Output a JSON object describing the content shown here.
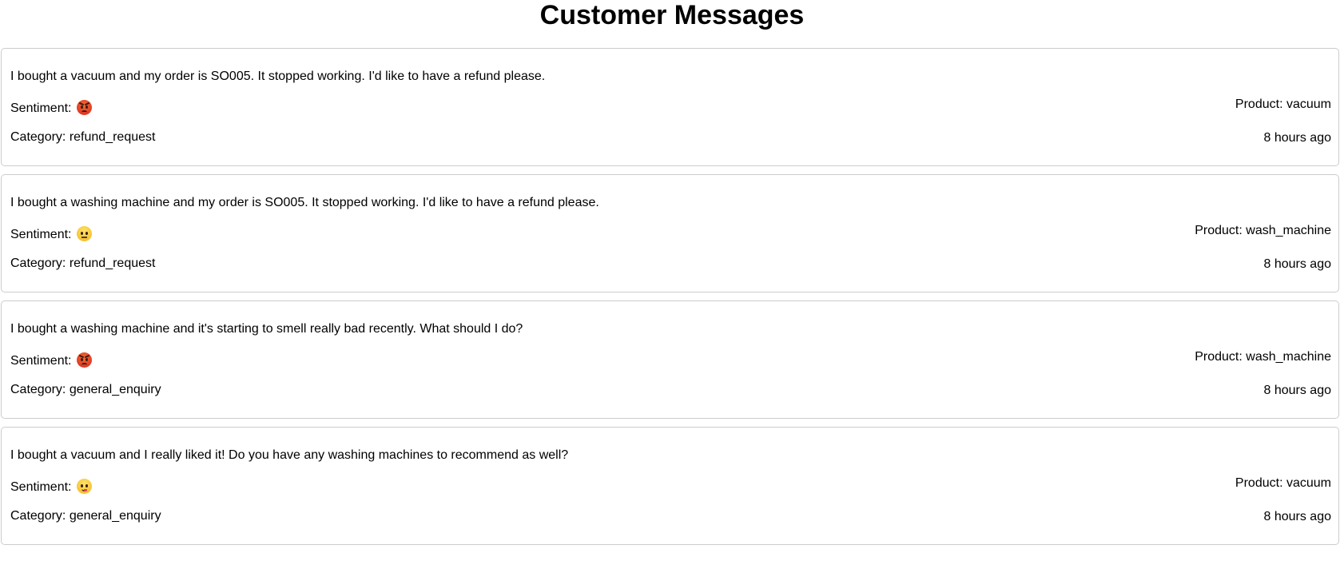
{
  "page": {
    "title": "Customer Messages"
  },
  "messages": [
    {
      "text": "I bought a vacuum and my order is SO005. It stopped working. I'd like to have a refund please.",
      "sentiment_label": "Sentiment:",
      "sentiment_icon": "angry-face-icon",
      "category_label": "Category:",
      "category": "refund_request",
      "product_label": "Product:",
      "product": "vacuum",
      "time": "8 hours ago"
    },
    {
      "text": "I bought a washing machine and my order is SO005. It stopped working. I'd like to have a refund please.",
      "sentiment_label": "Sentiment:",
      "sentiment_icon": "neutral-face-icon",
      "category_label": "Category:",
      "category": "refund_request",
      "product_label": "Product:",
      "product": "wash_machine",
      "time": "8 hours ago"
    },
    {
      "text": "I bought a washing machine and it's starting to smell really bad recently. What should I do?",
      "sentiment_label": "Sentiment:",
      "sentiment_icon": "angry-face-icon",
      "category_label": "Category:",
      "category": "general_enquiry",
      "product_label": "Product:",
      "product": "wash_machine",
      "time": "8 hours ago"
    },
    {
      "text": "I bought a vacuum and I really liked it! Do you have any washing machines to recommend as well?",
      "sentiment_label": "Sentiment:",
      "sentiment_icon": "happy-face-icon",
      "category_label": "Category:",
      "category": "general_enquiry",
      "product_label": "Product:",
      "product": "vacuum",
      "time": "8 hours ago"
    }
  ],
  "colors": {
    "card_border": "#cccccc",
    "angry": "#d8261d",
    "neutral": "#f2b51c",
    "happy": "#f2b51c"
  }
}
